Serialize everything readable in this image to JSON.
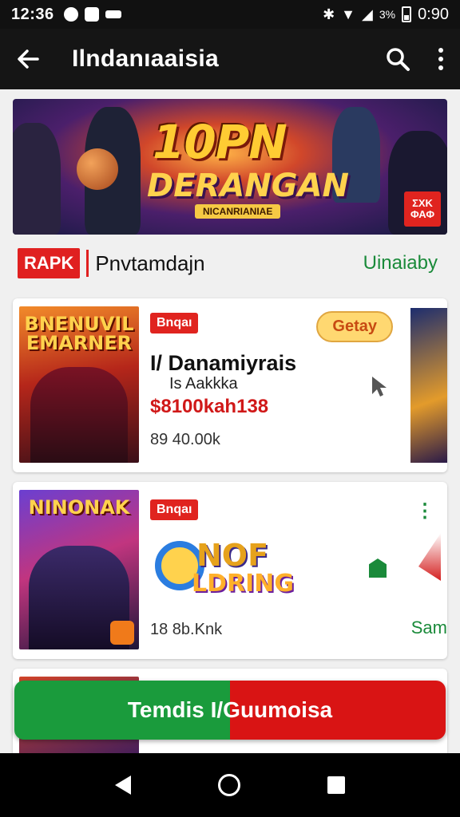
{
  "status": {
    "time": "12:36",
    "battery": "3%",
    "clock": "0:90"
  },
  "appbar": {
    "title": "Ilndanıaaisia"
  },
  "banner": {
    "title_line1": "10PN",
    "title_line2": "DERANGAN",
    "tagline": "NICANRIANIAE",
    "badge": "ΣΧΚ ΦΑΦ"
  },
  "section": {
    "logo": "RAPK",
    "title": "Pnvtamdajn",
    "link": "Uinaiaby"
  },
  "card1": {
    "thumb_text": "BNENUVIL EMARNER",
    "tag": "Bnqaı",
    "get_button": "Getay",
    "name": "I/ Danamiyrais",
    "sub": "Is Aakkka",
    "price": "$8100kah138",
    "meta": "89  40.00k"
  },
  "card2": {
    "thumb_text": "NINONAK",
    "tag": "Bnqaı",
    "logo_line1": "NOF",
    "logo_line2": "LDRING",
    "meta": "18  8b.Knk",
    "side_text": "Sam"
  },
  "cta": {
    "label": "Temdis I/Guumoisa"
  },
  "colors": {
    "accent_red": "#e0241f",
    "accent_green": "#1a9b3c"
  }
}
